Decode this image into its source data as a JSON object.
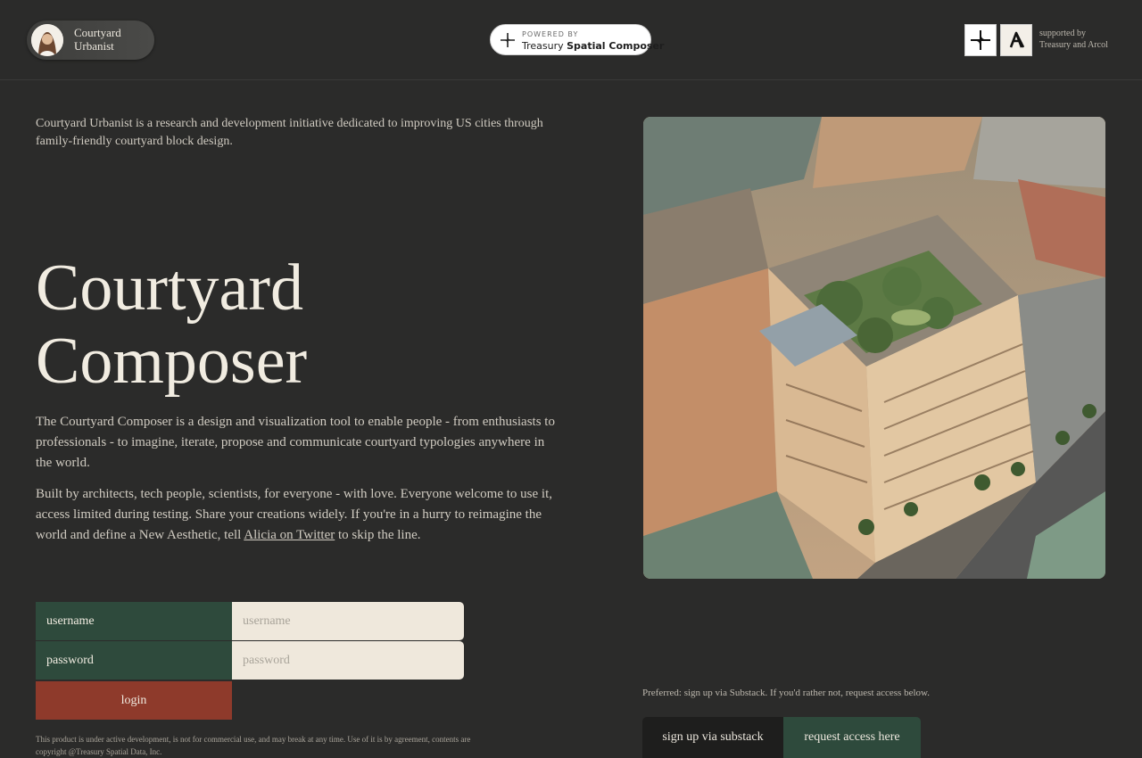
{
  "header": {
    "brand_line1": "Courtyard",
    "brand_line2": "Urbanist",
    "powered_small": "POWERED BY",
    "powered_name_a": "Treasury ",
    "powered_name_b": "Spatial Composer",
    "supported_line1": "supported by",
    "supported_line2": "Treasury and Arcol"
  },
  "intro": "Courtyard Urbanist is a research and development initiative dedicated to improving US cities through family-friendly courtyard block design.",
  "title_line1": "Courtyard",
  "title_line2": "Composer",
  "description1": "The Courtyard Composer is a design and visualization tool to enable people - from enthusiasts to professionals - to imagine, iterate, propose and communicate courtyard typologies anywhere in the world.",
  "description2_before": "Built by architects, tech people, scientists, for everyone - with love. Everyone welcome to use it, access limited during testing. Share your creations widely. If you're in a hurry to reimagine the world and define a New Aesthetic, tell ",
  "description2_link": "Alicia on Twitter",
  "description2_after": " to skip the line.",
  "form": {
    "username_label": "username",
    "username_placeholder": "username",
    "password_label": "password",
    "password_placeholder": "password",
    "login_label": "login"
  },
  "legal": "This product is under active development, is not for commercial use, and may break at any time. Use of it is by agreement, contents are copyright @Treasury Spatial Data, Inc.",
  "signup": {
    "preferred_text": "Preferred: sign up via Substack. If you'd rather not, request access below.",
    "substack_label": "sign up via substack",
    "request_label": "request access here"
  },
  "colors": {
    "background": "#2b2b2a",
    "green": "#2e4a3c",
    "red": "#8e3a2b",
    "input_bg": "#efe8dc"
  }
}
